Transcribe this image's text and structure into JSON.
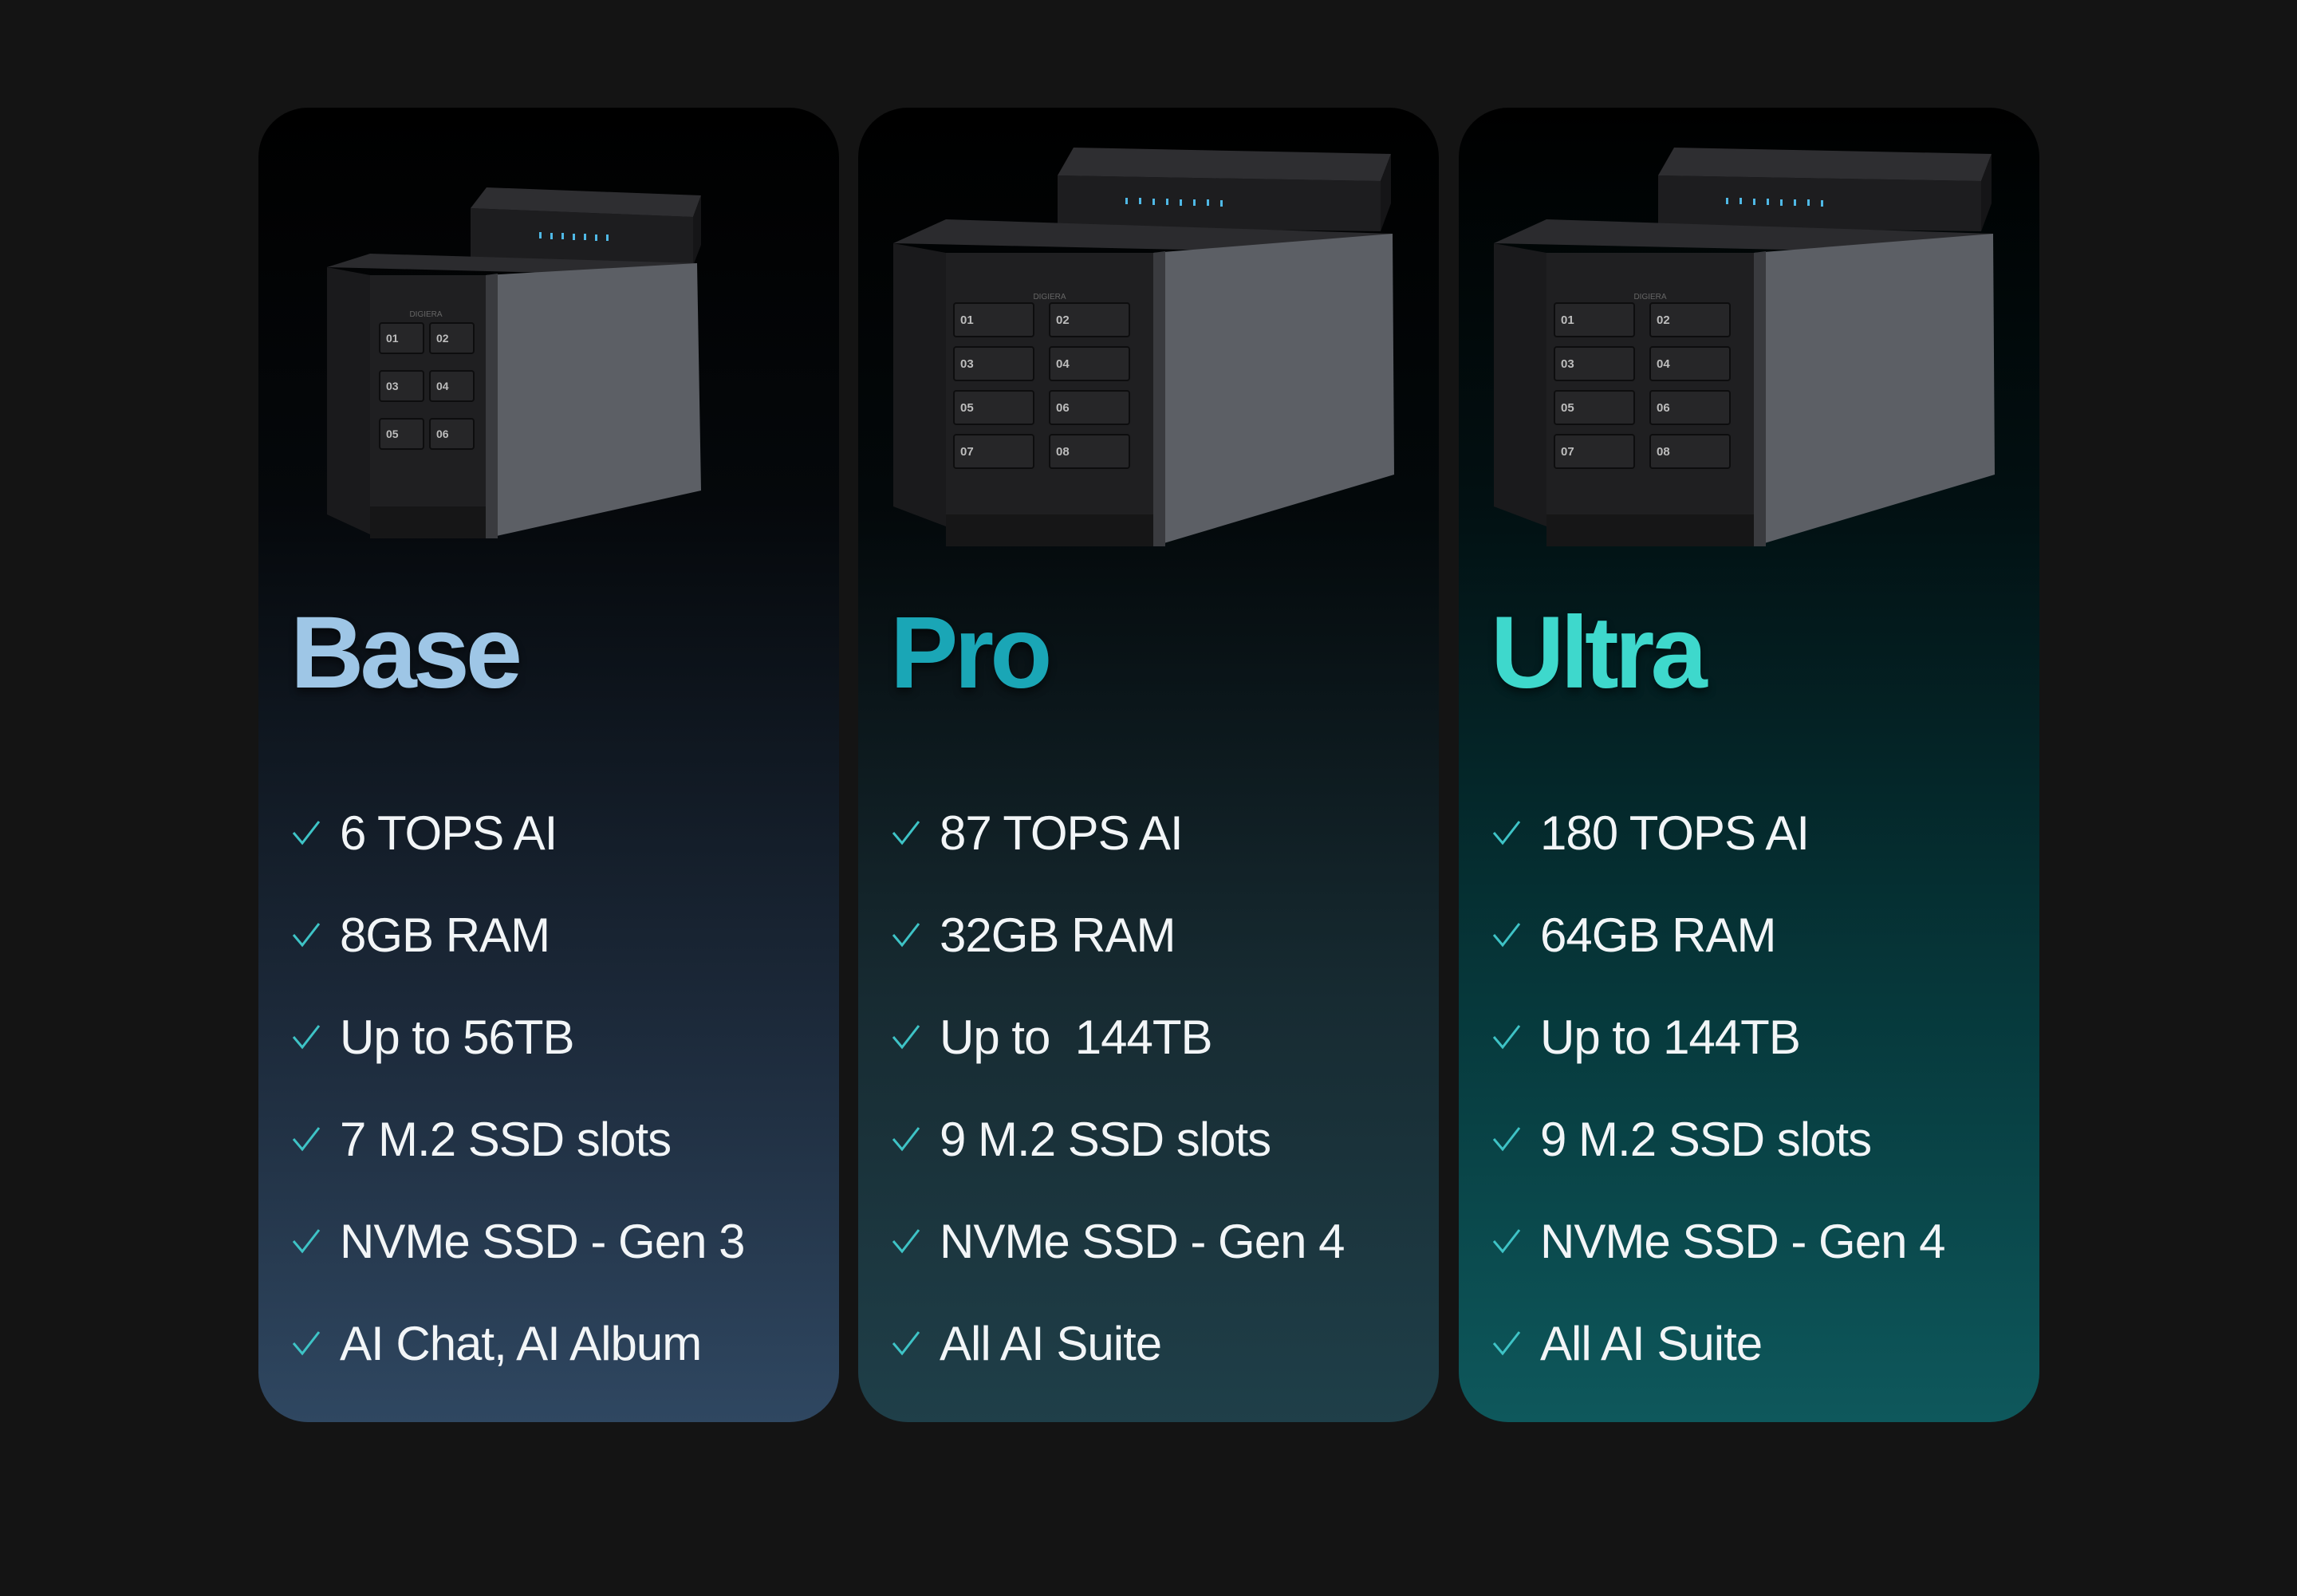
{
  "colors": {
    "background": "#141414",
    "check": "#3ec3c6",
    "feature_text": "#f2f5f7"
  },
  "cards": [
    {
      "id": "base",
      "name": "Base",
      "name_color": "#9ec6e6",
      "bay_labels": [
        "01",
        "02",
        "03",
        "04",
        "05",
        "06"
      ],
      "features": [
        "6 TOPS AI",
        "8GB RAM",
        "Up to 56TB",
        "7 M.2 SSD slots",
        "NVMe SSD - Gen 3",
        "AI Chat, AI Album"
      ]
    },
    {
      "id": "pro",
      "name": "Pro",
      "name_color": "#1aa6b6",
      "bay_labels": [
        "01",
        "02",
        "03",
        "04",
        "05",
        "06",
        "07",
        "08"
      ],
      "features": [
        "87 TOPS AI",
        "32GB RAM",
        "Up to  144TB",
        "9 M.2 SSD slots",
        "NVMe SSD - Gen 4",
        "All AI Suite"
      ]
    },
    {
      "id": "ultra",
      "name": "Ultra",
      "name_color": "#3ed8cc",
      "bay_labels": [
        "01",
        "02",
        "03",
        "04",
        "05",
        "06",
        "07",
        "08"
      ],
      "features": [
        "180 TOPS AI",
        "64GB RAM",
        "Up to 144TB",
        "9 M.2 SSD slots",
        "NVMe SSD - Gen 4",
        "All AI Suite"
      ]
    }
  ]
}
